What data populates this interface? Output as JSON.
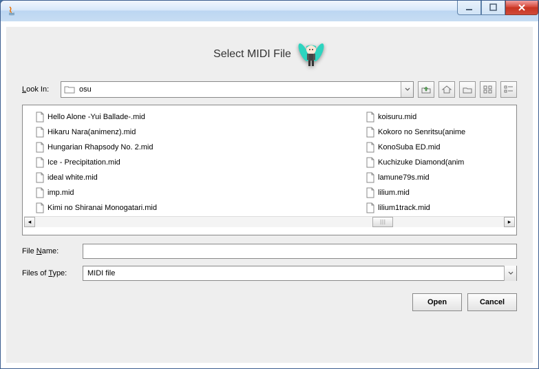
{
  "dialog": {
    "title": "Select MIDI File"
  },
  "lookin": {
    "label": "Look In:",
    "folder": "osu"
  },
  "files": {
    "column1": [
      "Hello Alone -Yui Ballade-.mid",
      "Hikaru Nara(animenz).mid",
      "Hungarian Rhapsody No. 2.mid",
      "Ice - Precipitation.mid",
      "ideal white.mid",
      "imp.mid",
      "Kimi no Shiranai Monogatari.mid"
    ],
    "column2": [
      "koisuru.mid",
      "Kokoro no Senritsu(anime",
      "KonoSuba ED.mid",
      "Kuchizuke Diamond(anim",
      "lamune79s.mid",
      "lilium.mid",
      "lilium1track.mid"
    ]
  },
  "filename": {
    "label": "File Name:",
    "value": ""
  },
  "filetype": {
    "label": "Files of Type:",
    "value": "MIDI file"
  },
  "buttons": {
    "open": "Open",
    "cancel": "Cancel"
  }
}
